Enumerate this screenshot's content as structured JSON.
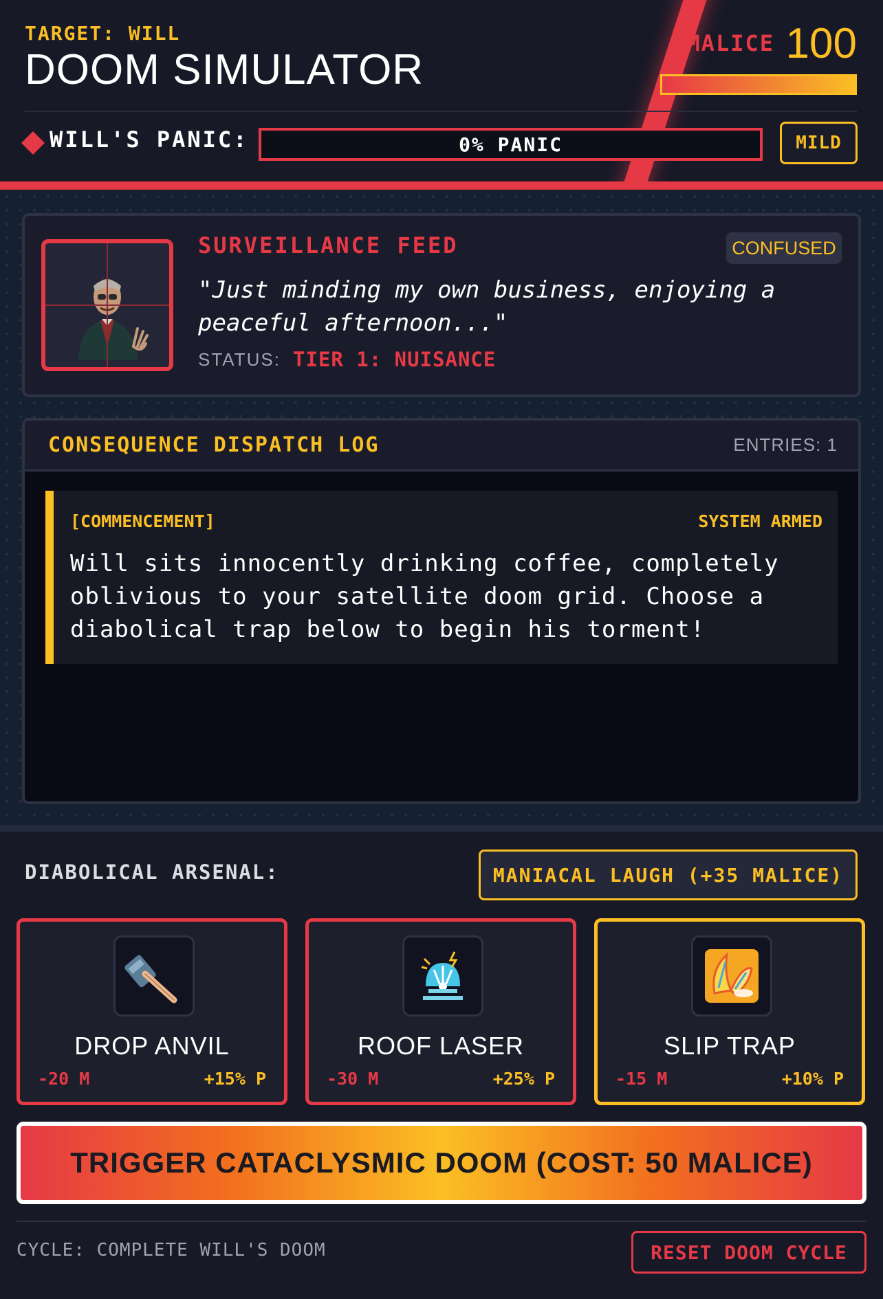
{
  "header": {
    "target": "TARGET: WILL",
    "title": "DOOM SIMULATOR",
    "malice_label": "MALICE",
    "malice_value": "100",
    "malice_fraction": 1.0,
    "panic_label": "WILL'S PANIC:",
    "panic_text": "0% PANIC",
    "panic_fraction": 0.0,
    "panic_level": "MILD"
  },
  "feed": {
    "title": "SURVEILLANCE FEED",
    "mood": "CONFUSED",
    "quote": "\"Just minding my own business, enjoying a peaceful afternoon...\"",
    "status_label": "STATUS:",
    "status_value": "TIER 1: NUISANCE"
  },
  "log": {
    "title": "CONSEQUENCE DISPATCH LOG",
    "entries_label": "ENTRIES: 1",
    "entries": [
      {
        "tag": "[COMMENCEMENT]",
        "state": "SYSTEM ARMED",
        "text": "Will sits innocently drinking coffee, completely oblivious to your satellite doom grid. Choose a diabolical trap below to begin his torment!"
      }
    ]
  },
  "arsenal": {
    "label": "DIABOLICAL ARSENAL:",
    "laugh_button": "MANIACAL LAUGH (+35 MALICE)",
    "items": [
      {
        "name": "DROP ANVIL",
        "cost": "-20 M",
        "gain": "+15% P",
        "icon": "hammer-icon"
      },
      {
        "name": "ROOF LASER",
        "cost": "-30 M",
        "gain": "+25% P",
        "icon": "laser-icon"
      },
      {
        "name": "SLIP TRAP",
        "cost": "-15 M",
        "gain": "+10% P",
        "icon": "banana-peel-icon"
      }
    ]
  },
  "actions": {
    "trigger": "TRIGGER CATACLYSMIC DOOM (COST: 50 MALICE)",
    "cycle": "CYCLE: COMPLETE WILL'S DOOM",
    "reset": "RESET DOOM CYCLE"
  },
  "colors": {
    "accent_red": "#e63946",
    "accent_gold": "#fbbf24",
    "background": "#171927"
  }
}
